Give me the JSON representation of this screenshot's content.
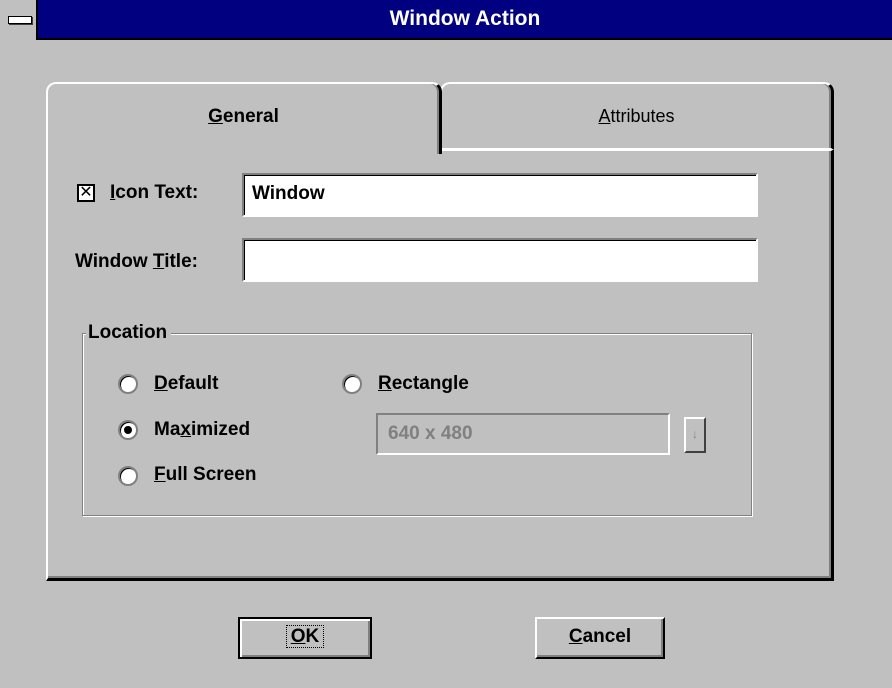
{
  "window": {
    "title": "Window Action"
  },
  "tabs": {
    "general": {
      "label": "General",
      "accel": "G",
      "rest": "eneral"
    },
    "attributes": {
      "label": "Attributes",
      "accel": "A",
      "rest": "ttributes"
    }
  },
  "icon_text": {
    "checkbox_mark": "✕",
    "checked": true,
    "label_accel": "I",
    "label_rest": "con Text:",
    "value": "Window"
  },
  "window_title": {
    "label_pre": "Window ",
    "label_accel": "T",
    "label_rest": "itle:",
    "value": ""
  },
  "location": {
    "label": "Location",
    "default": {
      "accel": "D",
      "rest": "efault",
      "selected": false
    },
    "maximized": {
      "pre": "Ma",
      "accel": "x",
      "rest": "imized",
      "selected": true
    },
    "full_screen": {
      "accel": "F",
      "rest": "ull Screen",
      "selected": false
    },
    "rectangle": {
      "accel": "R",
      "rest": "ectangle",
      "selected": false
    },
    "size_value": "640 x 480",
    "dropdown_glyph": "↓"
  },
  "buttons": {
    "ok": {
      "label": "OK",
      "accel": "O",
      "rest": "K"
    },
    "cancel": {
      "label": "Cancel",
      "accel": "C",
      "rest": "ancel"
    }
  }
}
